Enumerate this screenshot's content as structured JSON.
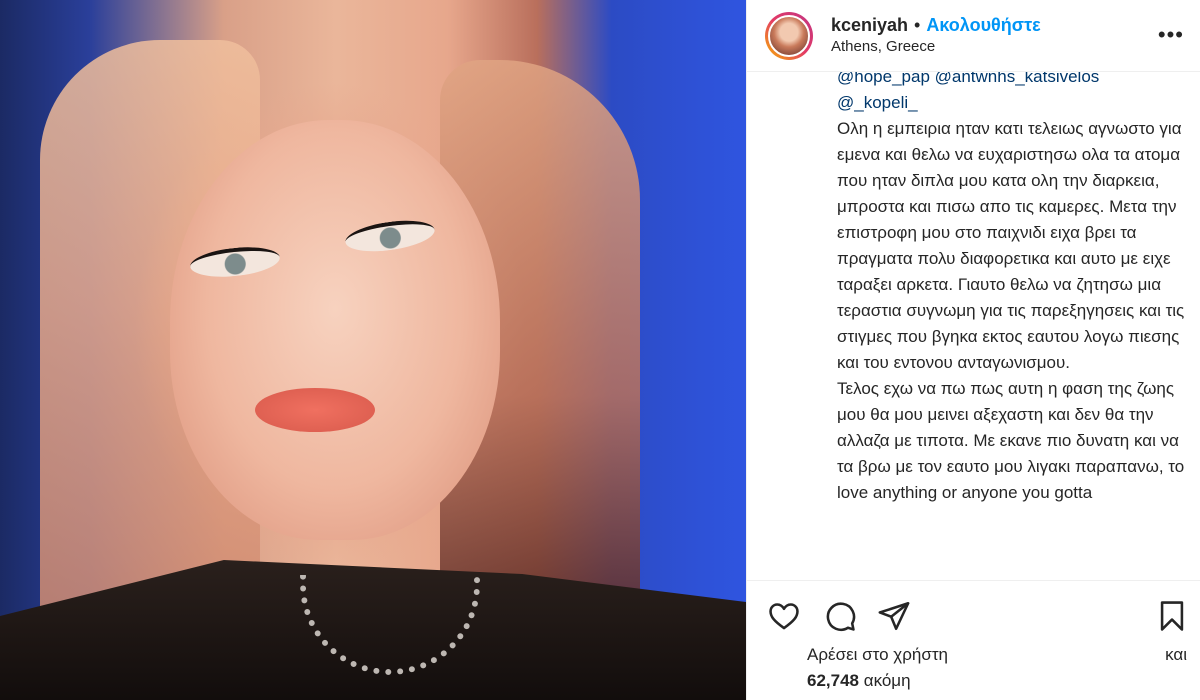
{
  "post": {
    "username": "kceniyah",
    "separator": "•",
    "follow_label": "Ακολουθήστε",
    "location": "Athens, Greece",
    "more_icon": "•••",
    "photo_description_icon": "portrait-photo"
  },
  "caption": {
    "mentions_partial": "@hope_pap @antwnhs_katsivelos",
    "mention_kopeli": "@_kopeli_",
    "body": "Ολη η εμπειρια ηταν κατι τελειως αγνωστο για εμενα και θελω να ευχαριστησω ολα τα ατομα που ηταν διπλα μου κατα ολη την διαρκεια, μπροστα και πισω απο τις καμερες. Μετα την επιστροφη μου στο παιχνιδι ειχα βρει τα πραγματα πολυ διαφορετικα και αυτο με ειχε ταραξει αρκετα. Γιαυτο θελω να ζητησω μια τεραστια συγνωμη για τις παρεξηγησεις και τις στιγμες που βγηκα εκτος εαυτου λογω πιεσης και του εντονου ανταγωνισμου.\nΤελος εχω να πω πως αυτη η φαση της ζωης μου θα μου μεινει αξεχαστη και δεν θα την αλλαζα με τιποτα. Με εκανε πιο δυνατη και να τα βρω με τον εαυτο μου λιγακι παραπανω, το love anything or anyone you gotta"
  },
  "actions": {
    "like_icon": "heart-icon",
    "comment_icon": "comment-icon",
    "share_icon": "share-icon",
    "save_icon": "bookmark-icon"
  },
  "likes": {
    "prefix": "Αρέσει στο χρήστη",
    "and": "και",
    "count": "62,748",
    "suffix": "ακόμη"
  }
}
